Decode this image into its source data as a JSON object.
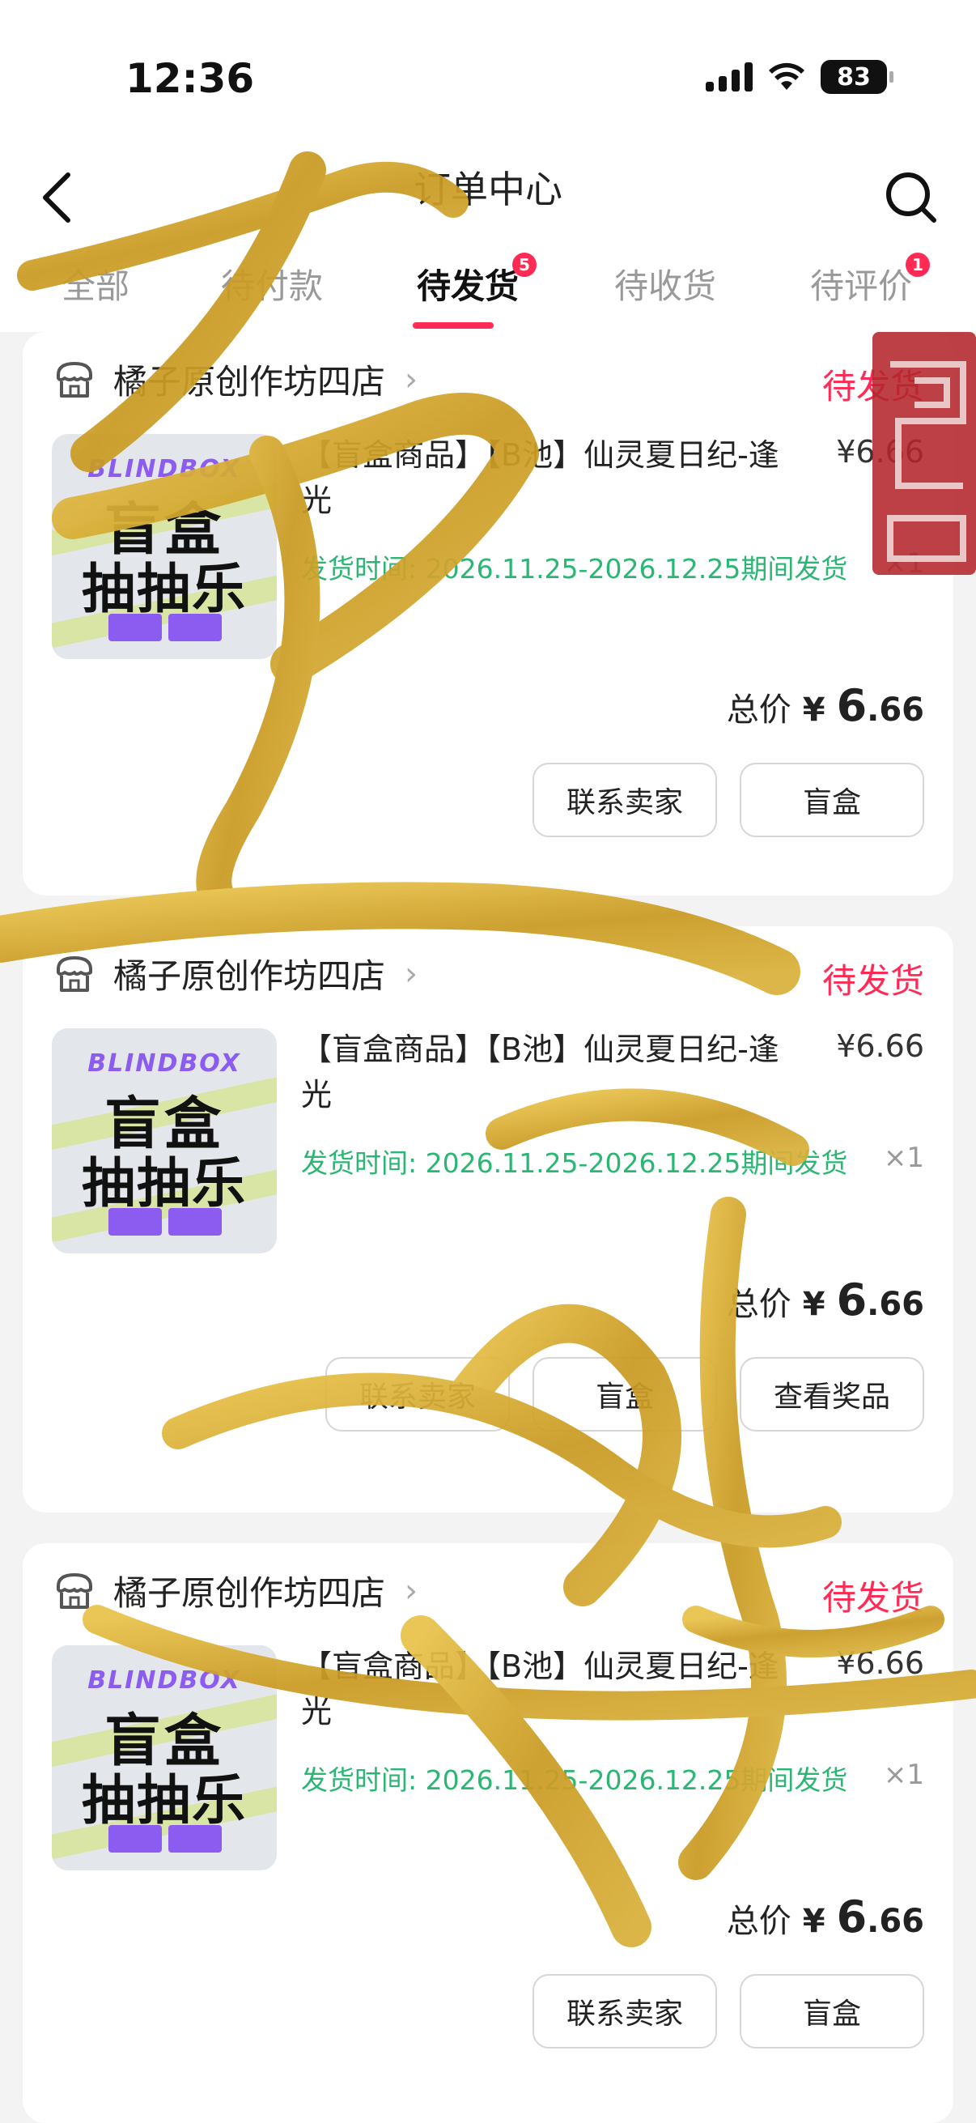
{
  "status_bar": {
    "time": "12:36",
    "battery": "83"
  },
  "header": {
    "title": "订单中心"
  },
  "tabs": [
    {
      "label": "全部",
      "badge": ""
    },
    {
      "label": "待付款",
      "badge": ""
    },
    {
      "label": "待发货",
      "badge": "5"
    },
    {
      "label": "待收货",
      "badge": ""
    },
    {
      "label": "待评价",
      "badge": "1"
    }
  ],
  "orders": [
    {
      "store": "橘子原创作坊四店",
      "status": "待发货",
      "product_title": "【盲盒商品】【B池】仙灵夏日纪-逢光",
      "price": "¥6.66",
      "ship_time": "发货时间: 2026.11.25-2026.12.25期间发货",
      "quantity": "×1",
      "total_label": "总价",
      "total_currency": "¥",
      "total_int": "6",
      "total_dec": ".66",
      "buttons": [
        "联系卖家",
        "盲盒"
      ]
    },
    {
      "store": "橘子原创作坊四店",
      "status": "待发货",
      "product_title": "【盲盒商品】【B池】仙灵夏日纪-逢光",
      "price": "¥6.66",
      "ship_time": "发货时间: 2026.11.25-2026.12.25期间发货",
      "quantity": "×1",
      "total_label": "总价",
      "total_currency": "¥",
      "total_int": "6",
      "total_dec": ".66",
      "buttons": [
        "联系卖家",
        "盲盒",
        "查看奖品"
      ]
    },
    {
      "store": "橘子原创作坊四店",
      "status": "待发货",
      "product_title": "【盲盒商品】【B池】仙灵夏日纪-逢光",
      "price": "¥6.66",
      "ship_time": "发货时间: 2026.11.25-2026.12.25期间发货",
      "quantity": "×1",
      "total_label": "总价",
      "total_currency": "¥",
      "total_int": "6",
      "total_dec": ".66",
      "buttons": [
        "联系卖家",
        "盲盒"
      ]
    }
  ],
  "thumbnail": {
    "brand": "BLINDBOX",
    "line1": "盲盒",
    "line2": "抽抽乐"
  },
  "colors": {
    "accent": "#ff2b55",
    "ship_green": "#2bb673",
    "gold": "#d4a72c",
    "seal_red": "#b3262b"
  }
}
